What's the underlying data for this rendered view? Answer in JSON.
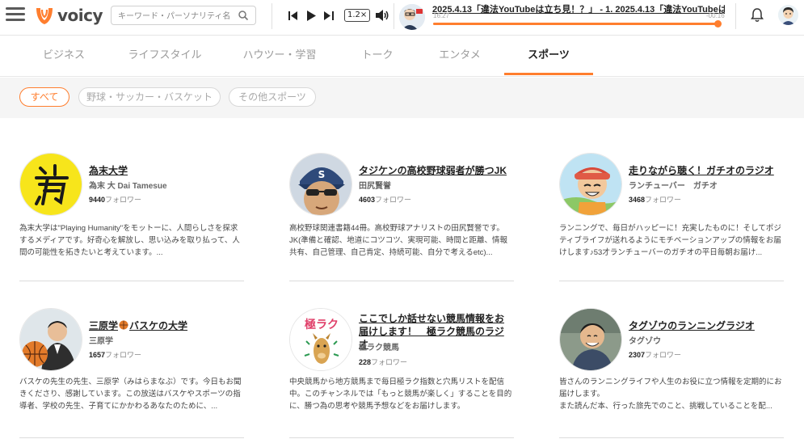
{
  "header": {
    "logo_text": "voicy",
    "search_placeholder": "キーワード・パーソナリティ名",
    "player": {
      "speed": "1.2×",
      "now_playing": "2025.4.13「違法YouTubeは立ち見！？」 - 1. 2025.4.13「違法YouTubeは立ち...",
      "time_current": "16:27",
      "time_remaining": "-00:16",
      "progress": 0.99
    }
  },
  "tabs": [
    {
      "label": "ビジネス"
    },
    {
      "label": "ライフスタイル"
    },
    {
      "label": "ハウツー・学習"
    },
    {
      "label": "トーク"
    },
    {
      "label": "エンタメ"
    },
    {
      "label": "スポーツ",
      "active": true
    }
  ],
  "filters": [
    {
      "label": "すべて",
      "active": true
    },
    {
      "label": "野球・サッカー・バスケット"
    },
    {
      "label": "その他スポーツ"
    }
  ],
  "followers_suffix": "フォロワー",
  "channels": [
    {
      "title": "為末大学",
      "owner": "為末 大 Dai Tamesue",
      "followers": "9440",
      "description": "為末大学は\"Playing Humanity\"をモットーに、人間らしさを探求するメディアです。好奇心を解放し、思い込みを取り払って、人間の可能性を拓きたいと考えています。..."
    },
    {
      "title": "タジケンの高校野球弱者が勝つJK",
      "owner": "田尻賢誉",
      "followers": "4603",
      "description": "高校野球関連書籍44冊。高校野球アナリストの田尻賢誉です。JK(準備と確認、地道にコツコツ、実現可能、時間と距離、情報共有、自己管理、自己肯定、持続可能、自分で考えるetc)..."
    },
    {
      "title": "走りながら聴く！ガチオのラジオ",
      "owner": "ランチューバー　ガチオ",
      "followers": "3468",
      "description": "ランニングで、毎日がハッピーに！充実したものに！そしてポジティブライフが送れるようにモチベーションアップの情報をお届けします♪53才ランチューバーのガチオの平日毎朝お届け..."
    },
    {
      "title_a": "三原学",
      "title_b": "バスケの大学",
      "owner": "三原学",
      "followers": "1657",
      "description": "バスケの先生の先生、三原学（みはらまなぶ）です。今日もお聞きくださり、感謝しています。この放送はバスケやスポーツの指導者、学校の先生、子育てにかかわるあなたのために、..."
    },
    {
      "title": "ここでしか話せない競馬情報をお届けします！　極ラク競馬のラジオ",
      "owner": "極ラク競馬",
      "followers": "228",
      "avatar_text": "極ラク",
      "description": "中央競馬から地方競馬まで毎日極ラク指数と穴馬リストを配信中。このチャンネルでは「もっと競馬が楽しく」することを目的に、勝つ為の思考や競馬予想などをお届けします。"
    },
    {
      "title": "タグゾウのランニングラジオ",
      "owner": "タグゾウ",
      "followers": "2307",
      "description": "皆さんのランニングライフや人生のお役に立つ情報を定期的にお届けします。\nまた読んだ本、行った旅先でのこと、挑戦していることを配..."
    }
  ],
  "colors": {
    "accent": "#ff7e2e",
    "tamesue_yellow": "#f7e51b"
  }
}
